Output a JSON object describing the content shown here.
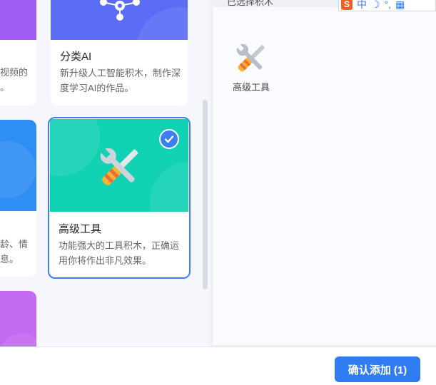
{
  "cards": {
    "classify_ai": {
      "title": "分类AI",
      "desc": "新升级人工智能积木，制作深度学习AI的作品。",
      "color": "#5b6df7"
    },
    "advanced_tools": {
      "title": "高级工具",
      "desc": "功能强大的工具积木，正确运用你将作出非凡效果。",
      "color": "#12d2b4",
      "selected": true
    },
    "partial_top": {
      "line1": "视频的",
      "line2": "。",
      "color": "#a15cf3"
    },
    "partial_middle": {
      "line1": "龄、情",
      "line2": "息。",
      "color": "#2f8ef4"
    },
    "partial_bottom": {
      "color": "#c56af2"
    }
  },
  "selected_panel": {
    "header": "已选择积木",
    "items": [
      {
        "label": "高级工具",
        "icon": "tools-icon"
      }
    ]
  },
  "ime": {
    "logo": "S",
    "lang": "中"
  },
  "footer": {
    "confirm_label": "确认添加 (1)"
  }
}
